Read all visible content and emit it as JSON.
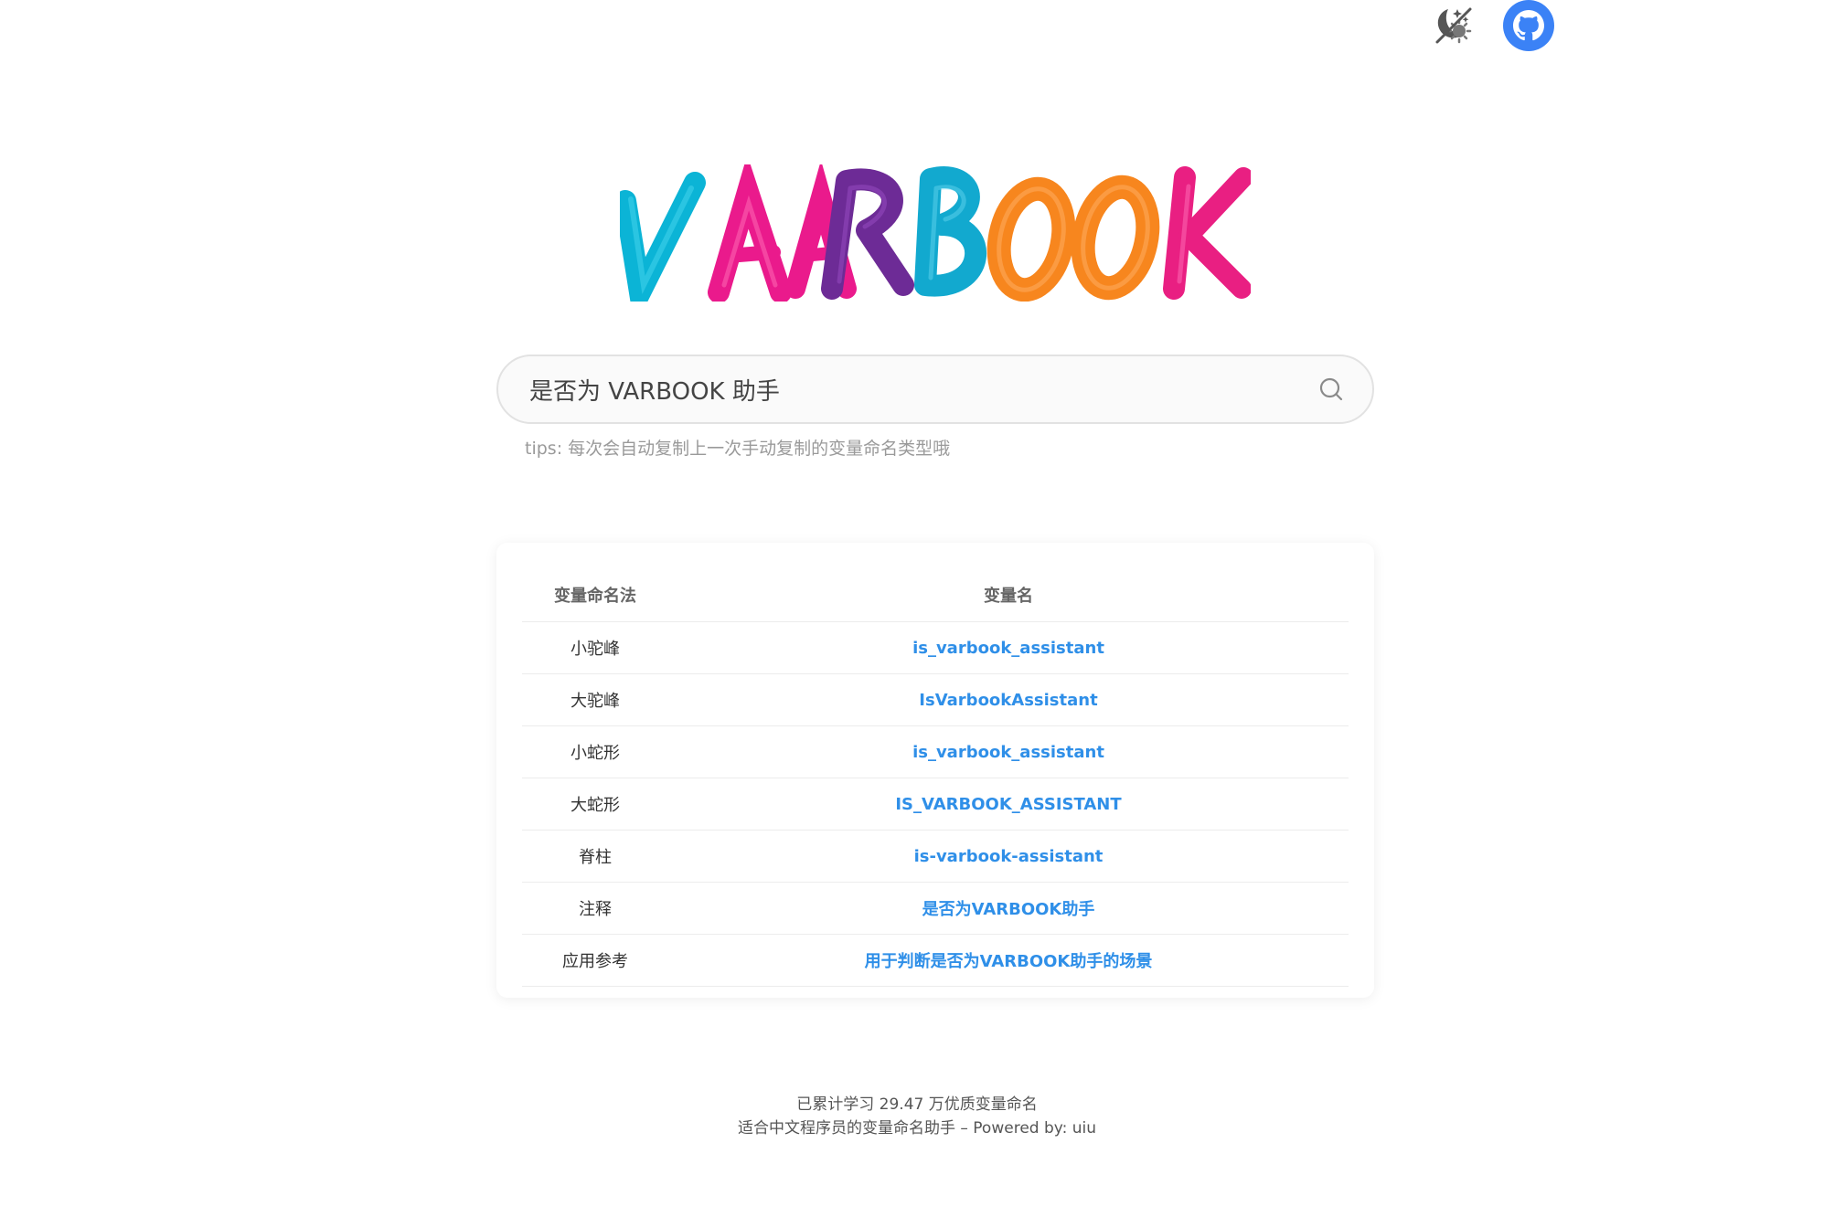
{
  "header": {
    "theme_toggle_icon": "moon-stars-icon",
    "github_icon": "github-icon",
    "accent_color": "#3b82f6"
  },
  "logo": {
    "text": "VARBOOK",
    "letter_colors": [
      "#0bb4d6",
      "#ea1a8c",
      "#ea1a8c",
      "#6d2b96",
      "#12a9cf",
      "#f7861e",
      "#f7861e",
      "#e91f82"
    ]
  },
  "search": {
    "value": "是否为 VARBOOK 助手",
    "placeholder": "",
    "icon": "search-icon"
  },
  "tips": "tips: 每次会自动复制上一次手动复制的变量命名类型哦",
  "table": {
    "headers": [
      "变量命名法",
      "变量名"
    ],
    "rows": [
      {
        "style": "小驼峰",
        "name": "is_varbook_assistant"
      },
      {
        "style": "大驼峰",
        "name": "IsVarbookAssistant"
      },
      {
        "style": "小蛇形",
        "name": "is_varbook_assistant"
      },
      {
        "style": "大蛇形",
        "name": "IS_VARBOOK_ASSISTANT"
      },
      {
        "style": "脊柱",
        "name": "is-varbook-assistant"
      },
      {
        "style": "注释",
        "name": "是否为VARBOOK助手"
      },
      {
        "style": "应用参考",
        "name": "用于判断是否为VARBOOK助手的场景"
      }
    ],
    "link_color": "#2f8fe8"
  },
  "footer": {
    "stats_prefix": "已累计学习 ",
    "stats_count": "29.47",
    "stats_suffix": " 万优质变量命名",
    "tagline": "适合中文程序员的变量命名助手 – Powered by: uiu"
  }
}
